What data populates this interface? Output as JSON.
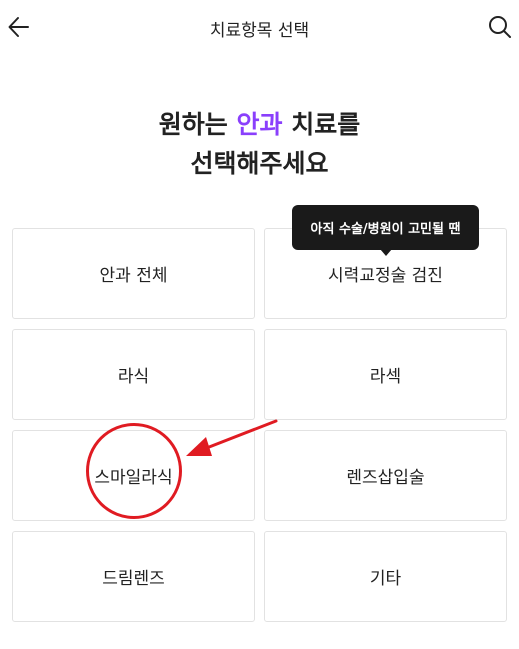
{
  "header": {
    "title": "치료항목 선택"
  },
  "heading": {
    "line1_pre": "원하는 ",
    "line1_accent": "안과",
    "line1_post": " 치료를",
    "line2": "선택해주세요"
  },
  "tooltip": {
    "text": "아직 수술/병원이 고민될 땐"
  },
  "options": {
    "all": "안과 전체",
    "vision_check": "시력교정술 검진",
    "lasik": "라식",
    "lasek": "라섹",
    "smile_lasik": "스마일라식",
    "lens_implant": "렌즈삽입술",
    "dream_lens": "드림렌즈",
    "other": "기타"
  },
  "colors": {
    "accent": "#8a3ffc",
    "tooltip_bg": "#1a1a1a",
    "annotation": "#e01b22",
    "card_border": "#e2e2e2"
  },
  "icons": {
    "back": "arrow-left-icon",
    "search": "search-icon"
  }
}
